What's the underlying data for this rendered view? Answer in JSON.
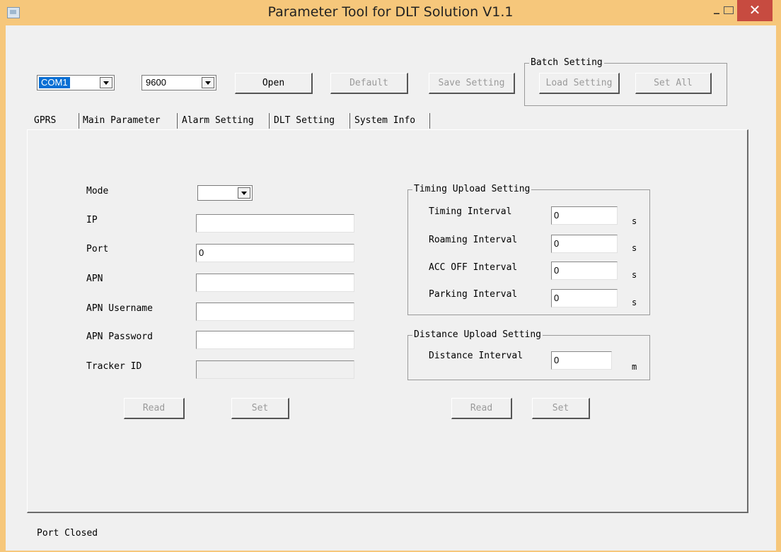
{
  "window": {
    "title": "Parameter Tool for DLT Solution V1.1",
    "min_label": "–",
    "close_label": "✕"
  },
  "toolbar": {
    "port": "COM1",
    "baud": "9600",
    "open": "Open",
    "default": "Default",
    "save_setting": "Save Setting"
  },
  "batch": {
    "title": "Batch Setting",
    "load_setting": "Load Setting",
    "set_all": "Set All"
  },
  "tabs": [
    "GPRS",
    "Main Parameter",
    "Alarm Setting",
    "DLT Setting",
    "System Info"
  ],
  "gprs": {
    "mode_label": "Mode",
    "mode_value": "",
    "ip_label": "IP",
    "ip_value": "",
    "port_label": "Port",
    "port_value": "0",
    "apn_label": "APN",
    "apn_value": "",
    "apn_user_label": "APN Username",
    "apn_user_value": "",
    "apn_pass_label": "APN Password",
    "apn_pass_value": "",
    "tracker_label": "Tracker ID",
    "tracker_value": "",
    "read": "Read",
    "set": "Set"
  },
  "timing": {
    "title": "Timing Upload Setting",
    "rows": [
      {
        "label": "Timing Interval",
        "value": "0",
        "unit": "s"
      },
      {
        "label": "Roaming Interval",
        "value": "0",
        "unit": "s"
      },
      {
        "label": "ACC OFF Interval",
        "value": "0",
        "unit": "s"
      },
      {
        "label": "Parking Interval",
        "value": "0",
        "unit": "s"
      }
    ]
  },
  "distance": {
    "title": "Distance Upload Setting",
    "label": "Distance Interval",
    "value": "0",
    "unit": "m",
    "read": "Read",
    "set": "Set"
  },
  "status": "Port Closed"
}
